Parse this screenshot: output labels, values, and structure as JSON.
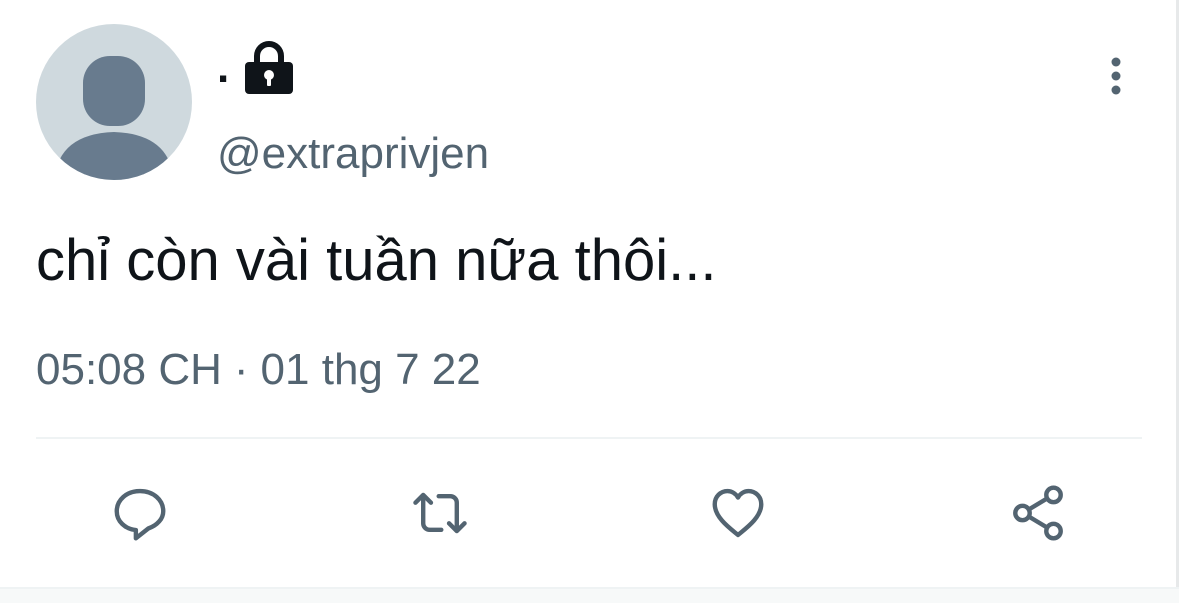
{
  "tweet": {
    "author": {
      "display_name": ".",
      "handle": "@extraprivjen",
      "protected_icon": "lock-icon",
      "avatar": "default-avatar"
    },
    "text": "chỉ còn vài tuần nữa thôi...",
    "time": "05:08 CH",
    "separator": "·",
    "date": "01 thg 7 22"
  },
  "icons": {
    "more": "more-vertical-icon",
    "reply": "reply-icon",
    "retweet": "retweet-icon",
    "like": "heart-icon",
    "share": "share-icon"
  },
  "colors": {
    "text_primary": "#0f1419",
    "text_secondary": "#536471",
    "avatar_bg": "#cfd9de",
    "avatar_figure": "#687b8e",
    "divider": "#eff3f4"
  }
}
